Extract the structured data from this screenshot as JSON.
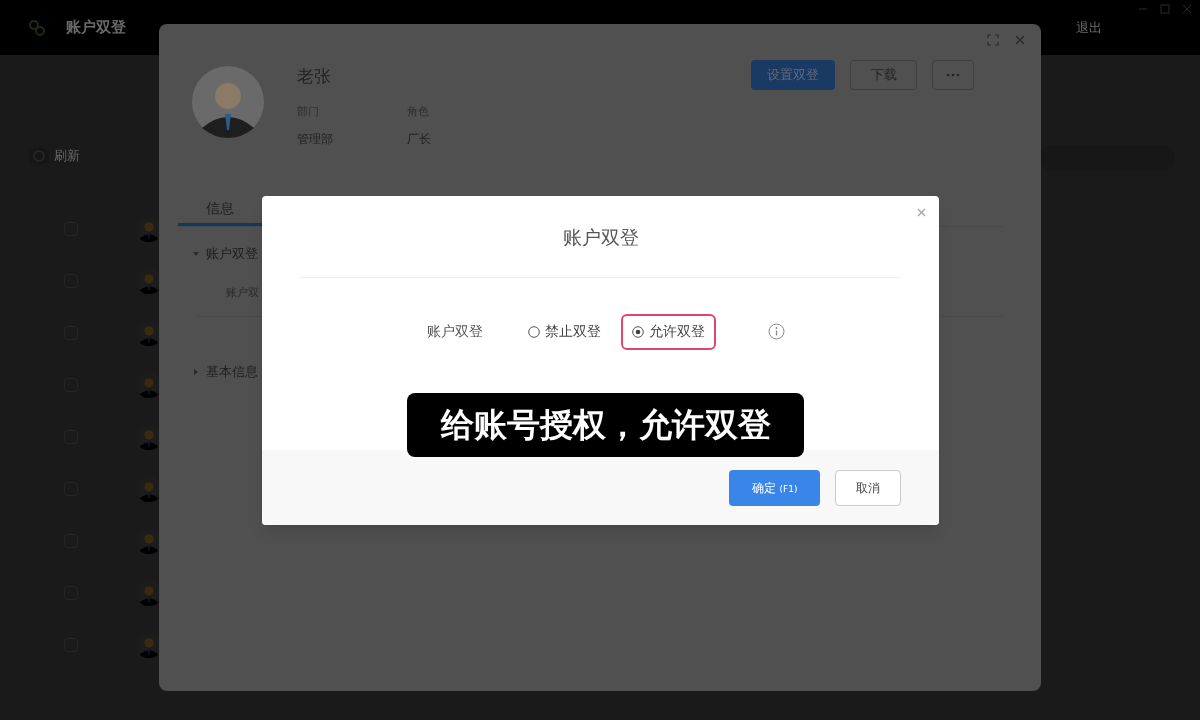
{
  "app": {
    "title": "账户双登",
    "refresh": "刷新",
    "logout": "退出",
    "rows": [
      {
        "checked": false
      },
      {
        "checked": false
      },
      {
        "checked": false
      },
      {
        "checked": false
      },
      {
        "checked": false
      },
      {
        "checked": false
      },
      {
        "checked": false
      },
      {
        "checked": false
      },
      {
        "checked": false
      }
    ]
  },
  "profile": {
    "name": "老张",
    "fields": [
      {
        "label": "部门",
        "value": "管理部"
      },
      {
        "label": "角色",
        "value": "厂长"
      }
    ],
    "actions": [
      {
        "label": "设置双登",
        "kind": "primary"
      },
      {
        "label": "下载",
        "kind": "secondary"
      }
    ],
    "tabs": [
      {
        "label": "信息",
        "selected": true
      }
    ],
    "sections": [
      {
        "title": "账户双登",
        "expanded": true,
        "rows": [
          "账户双"
        ]
      },
      {
        "title": "基本信息",
        "expanded": false
      }
    ]
  },
  "dialog": {
    "title": "账户双登",
    "field_label": "账户双登",
    "options": [
      {
        "label": "禁止双登",
        "selected": false,
        "highlighted": false
      },
      {
        "label": "允许双登",
        "selected": true,
        "highlighted": true
      }
    ],
    "buttons": [
      {
        "label": "确定",
        "shortcut": "(F1)",
        "kind": "primary"
      },
      {
        "label": "取消",
        "kind": "secondary"
      }
    ]
  },
  "caption": "给账号授权，允许双登"
}
